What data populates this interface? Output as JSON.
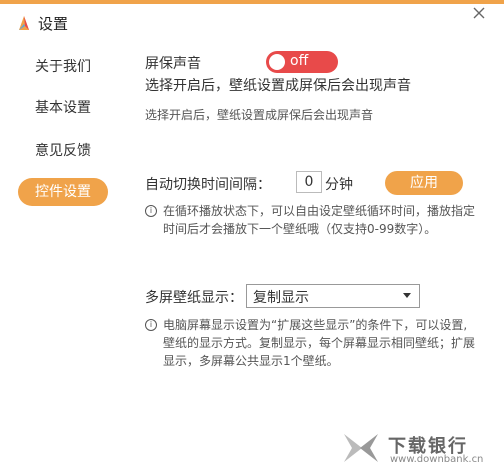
{
  "window": {
    "title": "设置",
    "accent": "#f0a34a",
    "toggle_off_color": "#e84a4a"
  },
  "sidebar": {
    "items": [
      {
        "label": "关于我们"
      },
      {
        "label": "基本设置"
      },
      {
        "label": "意见反馈"
      },
      {
        "label": "控件设置",
        "active": true
      }
    ]
  },
  "sound": {
    "label": "屏保声音",
    "toggle_state": "off",
    "desc_main": "选择开启后，壁纸设置成屏保后会出现声音",
    "desc_sub": "选择开启后，壁纸设置成屏保后会出现声音"
  },
  "interval": {
    "label": "自动切换时间间隔：",
    "value": "0",
    "unit": "分钟",
    "apply_label": "应用",
    "note_line1": "在循环播放状态下，可以自由设定壁纸循环时间，播放指定",
    "note_line2": "时间后才会播放下一个壁纸哦（仅支持0-99数字）。"
  },
  "multiscreen": {
    "label": "多屏壁纸显示：",
    "selected": "复制显示",
    "note_line1": "电脑屏幕显示设置为“扩展这些显示”的条件下，可以设置,",
    "note_line2": "壁纸的显示方式。复制显示，每个屏幕显示相同壁纸；扩展",
    "note_line3": "显示，多屏幕公共显示1个壁纸。"
  },
  "watermark": {
    "name": "下载银行",
    "url": "www.downbank.cn"
  }
}
